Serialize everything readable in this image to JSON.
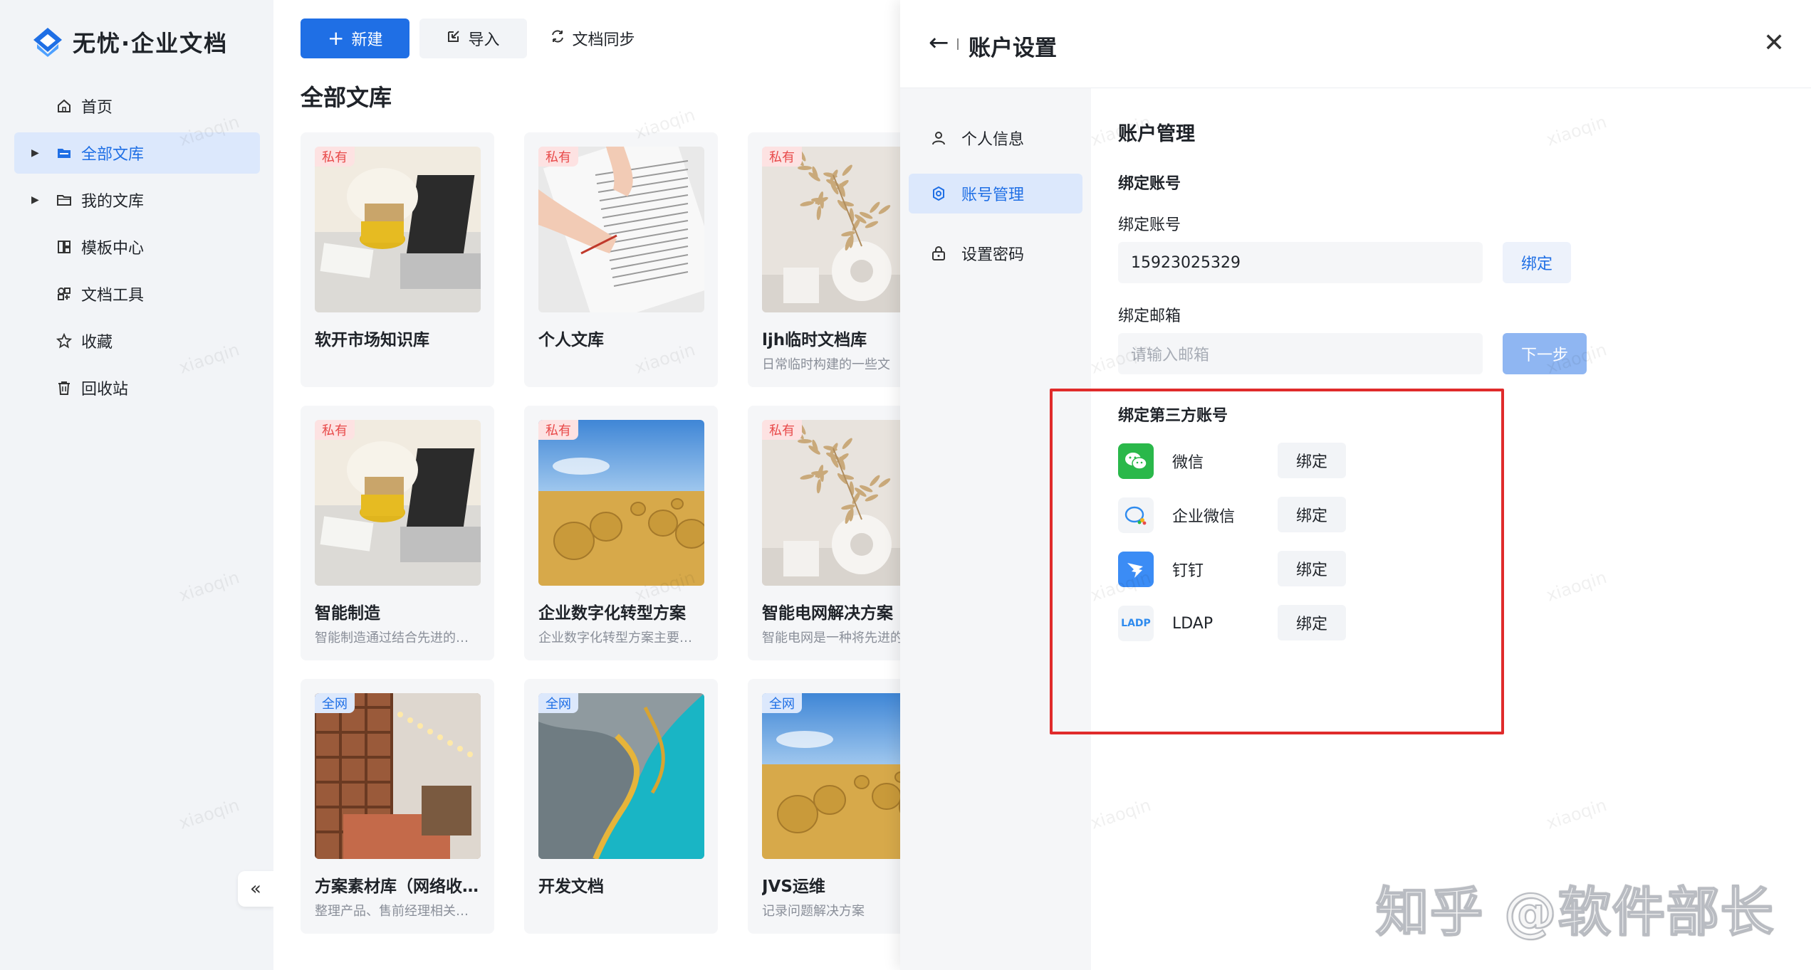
{
  "brand": {
    "logo_text": "无忧·企业文档"
  },
  "sidebar": {
    "items": [
      {
        "label": "首页",
        "icon": "home-icon"
      },
      {
        "label": "全部文库",
        "icon": "folder-filled-icon",
        "active": true,
        "expandable": true
      },
      {
        "label": "我的文库",
        "icon": "folder-icon",
        "expandable": true
      },
      {
        "label": "模板中心",
        "icon": "template-icon"
      },
      {
        "label": "文档工具",
        "icon": "tools-icon"
      },
      {
        "label": "收藏",
        "icon": "star-icon"
      },
      {
        "label": "回收站",
        "icon": "trash-icon"
      }
    ],
    "collapse_label": "«"
  },
  "toolbar": {
    "new_label": "新建",
    "import_label": "导入",
    "sync_label": "文档同步"
  },
  "main": {
    "section_title": "全部文库",
    "cards": [
      {
        "tag": "私有",
        "tag_type": "private",
        "title": "软开市场知识库",
        "desc": "",
        "image": "desk-laptop"
      },
      {
        "tag": "私有",
        "tag_type": "private",
        "title": "个人文库",
        "desc": "",
        "image": "writing-hand"
      },
      {
        "tag": "私有",
        "tag_type": "private",
        "title": "ljh临时文档库",
        "desc": "日常临时构建的一些文",
        "image": "vase-pampas"
      },
      {
        "tag": "私有",
        "tag_type": "private",
        "title": "智能制造",
        "desc": "智能制造通过结合先进的…",
        "image": "desk-laptop"
      },
      {
        "tag": "私有",
        "tag_type": "private",
        "title": "企业数字化转型方案",
        "desc": "企业数字化转型方案主要…",
        "image": "hay-field"
      },
      {
        "tag": "私有",
        "tag_type": "private",
        "title": "智能电网解决方案",
        "desc": "智能电网是一种将先进的",
        "image": "vase-pampas"
      },
      {
        "tag": "全网",
        "tag_type": "public",
        "title": "方案素材库（网络收…",
        "desc": "整理产品、售前经理相关…",
        "image": "cafe-interior"
      },
      {
        "tag": "全网",
        "tag_type": "public",
        "title": "开发文档",
        "desc": "",
        "image": "aerial-lake"
      },
      {
        "tag": "全网",
        "tag_type": "public",
        "title": "JVS运维",
        "desc": "记录问题解决方案",
        "image": "hay-field"
      }
    ]
  },
  "panel": {
    "title": "账户设置",
    "nav": [
      {
        "label": "个人信息",
        "icon": "user-icon"
      },
      {
        "label": "账号管理",
        "icon": "gear-icon",
        "active": true
      },
      {
        "label": "设置密码",
        "icon": "lock-icon"
      }
    ],
    "content": {
      "heading": "账户管理",
      "bind_account_section": "绑定账号",
      "phone_label": "绑定账号",
      "phone_value": "15923025329",
      "phone_bind_label": "绑定",
      "email_label": "绑定邮箱",
      "email_placeholder": "请输入邮箱",
      "next_label": "下一步",
      "third_party_section": "绑定第三方账号",
      "third_party": [
        {
          "name": "微信",
          "icon": "wechat-icon",
          "bind_label": "绑定"
        },
        {
          "name": "企业微信",
          "icon": "wecom-icon",
          "bind_label": "绑定"
        },
        {
          "name": "钉钉",
          "icon": "dingtalk-icon",
          "bind_label": "绑定"
        },
        {
          "name": "LDAP",
          "icon": "ldap-icon",
          "bind_label": "绑定",
          "icon_text": "LADP"
        }
      ]
    }
  },
  "watermark_text": "xiaoqin",
  "footer_brand": "知乎 @软件部长",
  "colors": {
    "primary": "#1f6fe5",
    "highlight": "#e02b2b",
    "private_tag": "#e84a4a",
    "wechat": "#2ab84a",
    "dingtalk": "#3b8cf5"
  }
}
